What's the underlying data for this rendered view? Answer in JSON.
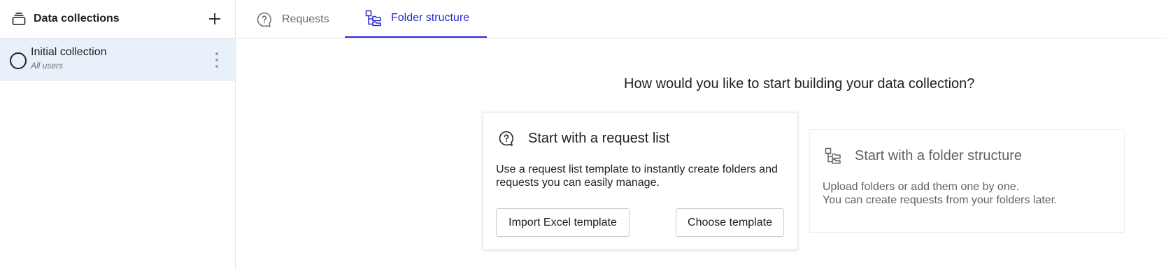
{
  "sidebar": {
    "title": "Data collections",
    "icons": {
      "header": "stack-icon",
      "add": "plus-icon",
      "menu": "kebab-menu-icon"
    },
    "collections": [
      {
        "name": "Initial collection",
        "subtitle": "All users"
      }
    ]
  },
  "tabs": [
    {
      "label": "Requests",
      "icon": "question-bubble-icon",
      "active": false
    },
    {
      "label": "Folder structure",
      "icon": "folder-tree-icon",
      "active": true
    }
  ],
  "main": {
    "question": "How would you like to start building your data collection?",
    "request_card": {
      "icon": "question-bubble-icon",
      "title": "Start with a request list",
      "description": "Use a request list template to instantly create folders and requests you can easily manage.",
      "import_label": "Import Excel template",
      "choose_label": "Choose template"
    },
    "folder_card": {
      "icon": "folder-tree-icon",
      "title": "Start with a folder structure",
      "description_line1": "Upload folders or add them one by one.",
      "description_line2": "You can create requests from your folders later."
    }
  },
  "colors": {
    "accent": "#2a2ad4",
    "selected_row": "#e8f1f9",
    "border": "#e3e5e8"
  }
}
